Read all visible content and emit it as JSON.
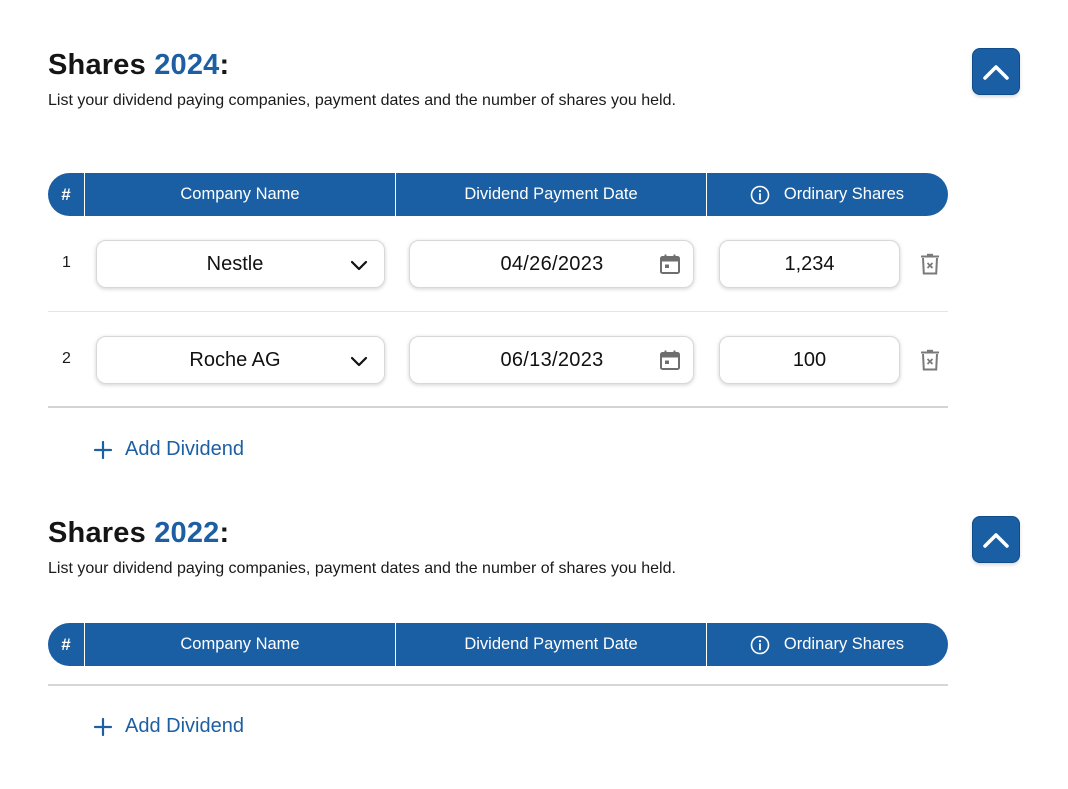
{
  "sections": [
    {
      "title_prefix": "Shares ",
      "year": "2024",
      "title_suffix": ":",
      "subtitle": "List your dividend paying companies, payment dates and the number of shares you held.",
      "rows": [
        {
          "num": "1",
          "company": "Nestle",
          "date": "04/26/2023",
          "shares": "1,234"
        },
        {
          "num": "2",
          "company": "Roche AG",
          "date": "06/13/2023",
          "shares": "100"
        }
      ],
      "add_label": "Add Dividend"
    },
    {
      "title_prefix": "Shares ",
      "year": "2022",
      "title_suffix": ":",
      "subtitle": "List your dividend paying companies, payment dates and the number of shares you held.",
      "rows": [],
      "add_label": "Add Dividend"
    }
  ],
  "table_headers": {
    "num": "#",
    "company": "Company Name",
    "date": "Dividend Payment Date",
    "shares": "Ordinary Shares"
  },
  "icons": {
    "collapse": "chevron-up-icon",
    "info": "info-icon",
    "dropdown": "chevron-down-icon",
    "calendar": "calendar-icon",
    "delete": "trash-icon",
    "add": "plus-icon"
  },
  "colors": {
    "primary": "#1a5fa4",
    "accent_text": "#1d5fa2",
    "icon_gray": "#7a7a7a"
  }
}
